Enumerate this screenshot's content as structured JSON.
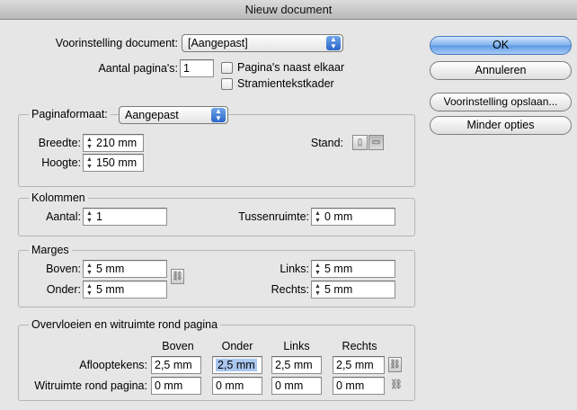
{
  "window": {
    "title": "Nieuw document"
  },
  "preset": {
    "label": "Voorinstelling document:",
    "value": "[Aangepast]"
  },
  "pages": {
    "label": "Aantal pagina's:",
    "value": "1",
    "facing_label": "Pagina's naast elkaar",
    "master_label": "Stramientekstkader",
    "facing_checked": false,
    "master_checked": false
  },
  "buttons": {
    "ok": "OK",
    "cancel": "Annuleren",
    "save_preset": "Voorinstelling opslaan...",
    "fewer": "Minder opties"
  },
  "page_size": {
    "label": "Paginaformaat:",
    "value": "Aangepast",
    "width_label": "Breedte:",
    "width": "210 mm",
    "height_label": "Hoogte:",
    "height": "150 mm",
    "orientation_label": "Stand:",
    "orientation_selected": "landscape"
  },
  "columns": {
    "title": "Kolommen",
    "count_label": "Aantal:",
    "count": "1",
    "gutter_label": "Tussenruimte:",
    "gutter": "0 mm"
  },
  "margins": {
    "title": "Marges",
    "top_label": "Boven:",
    "top": "5 mm",
    "bottom_label": "Onder:",
    "bottom": "5 mm",
    "left_label": "Links:",
    "left": "5 mm",
    "right_label": "Rechts:",
    "right": "5 mm"
  },
  "bleed": {
    "title": "Overvloeien en witruimte rond pagina",
    "headers": [
      "Boven",
      "Onder",
      "Links",
      "Rechts"
    ],
    "bleed_label": "Aflooptekens:",
    "bleed_values": [
      "2,5 mm",
      "2,5 mm",
      "2,5 mm",
      "2,5 mm"
    ],
    "slug_label": "Witruimte rond pagina:",
    "slug_values": [
      "0 mm",
      "0 mm",
      "0 mm",
      "0 mm"
    ]
  }
}
